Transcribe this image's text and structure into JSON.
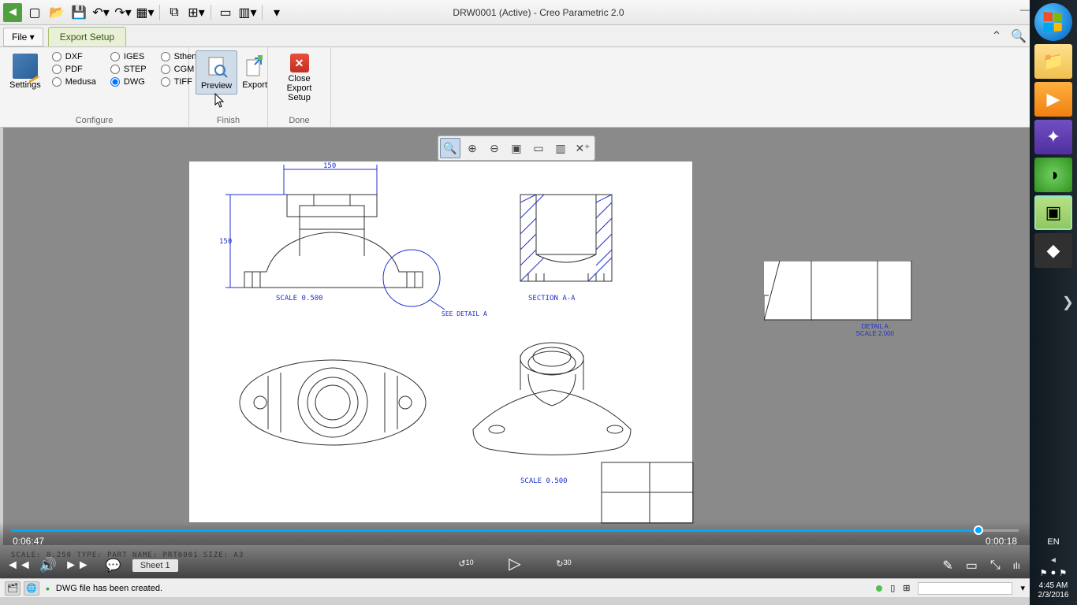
{
  "app_title": "DRW0001 (Active) - Creo Parametric 2.0",
  "menu": {
    "file": "File ▾",
    "active_tab": "Export Setup"
  },
  "ribbon": {
    "settings": "Settings",
    "formats": {
      "dxf": "DXF",
      "iges": "IGES",
      "stheno": "Stheno",
      "pdf": "PDF",
      "step": "STEP",
      "cgm": "CGM",
      "medusa": "Medusa",
      "dwg": "DWG",
      "tiff": "TIFF",
      "selected": "DWG"
    },
    "preview": "Preview",
    "export": "Export",
    "close": "Close Export\nSetup",
    "groups": {
      "configure": "Configure",
      "finish": "Finish",
      "done": "Done"
    }
  },
  "drawing": {
    "dim150_h": "150",
    "dim150_v": "150",
    "scale_main": "SCALE  0.500",
    "see_detail": "SEE DETAIL  A",
    "section": "SECTION  A-A",
    "scale_bottom": "SCALE  0.500",
    "detail_label": "DETAIL  A",
    "detail_scale": "SCALE  2.000"
  },
  "info_line": "SCALE: 0.250   TYPE: PART   NAME: PRT0001   SIZE: A3",
  "sheet_tab": "Sheet 1",
  "message": "DWG file has been created.",
  "video": {
    "elapsed": "0:06:47",
    "remaining": "0:00:18",
    "skip_back": "10",
    "skip_fwd": "30"
  },
  "tray": {
    "lang": "EN",
    "time": "4:45 AM",
    "date": "2/3/2016"
  }
}
